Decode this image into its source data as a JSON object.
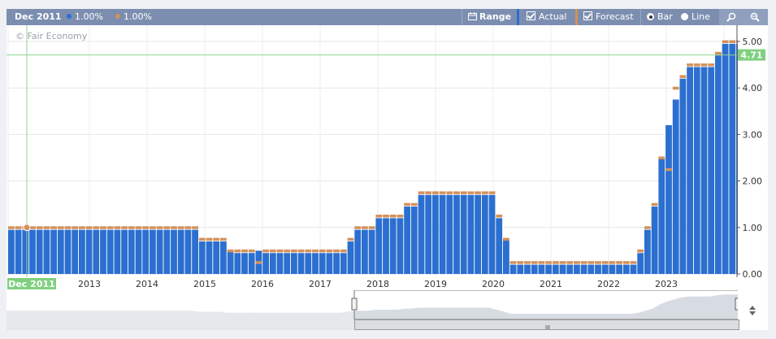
{
  "toolbar": {
    "date": "Dec 2011",
    "actual_value": "1.00%",
    "forecast_value": "1.00%",
    "range_label": "Range",
    "actual_label": "Actual",
    "forecast_label": "Forecast",
    "bar_label": "Bar",
    "line_label": "Line",
    "actual_color": "#2b6fd0",
    "forecast_color": "#d4915a"
  },
  "watermark": "© Fair Economy",
  "cursor_date": "Dec 2011",
  "current_value_label": "4.71",
  "chart_data": {
    "type": "bar",
    "ylim": [
      0,
      5
    ],
    "yticks": [
      "0.00",
      "1.00",
      "2.00",
      "3.00",
      "4.00",
      "5.00"
    ],
    "xticks": [
      "2013",
      "2014",
      "2015",
      "2016",
      "2017",
      "2018",
      "2019",
      "2020",
      "2021",
      "2022",
      "2023"
    ],
    "crosshair_value": 4.71,
    "series": [
      {
        "name": "Actual",
        "values": [
          0.95,
          0.95,
          0.95,
          0.95,
          0.95,
          0.95,
          0.95,
          0.95,
          0.95,
          0.95,
          0.95,
          0.95,
          0.95,
          0.95,
          0.95,
          0.95,
          0.95,
          0.95,
          0.95,
          0.95,
          0.95,
          0.95,
          0.95,
          0.95,
          0.95,
          0.95,
          0.95,
          0.7,
          0.7,
          0.7,
          0.7,
          0.5,
          0.45,
          0.45,
          0.45,
          0.5,
          0.45,
          0.45,
          0.45,
          0.45,
          0.45,
          0.45,
          0.45,
          0.45,
          0.45,
          0.45,
          0.45,
          0.45,
          0.7,
          0.95,
          0.95,
          0.95,
          1.2,
          1.2,
          1.2,
          1.2,
          1.45,
          1.45,
          1.7,
          1.7,
          1.7,
          1.7,
          1.7,
          1.7,
          1.7,
          1.7,
          1.7,
          1.7,
          1.7,
          1.2,
          0.75,
          0.2,
          0.2,
          0.2,
          0.2,
          0.2,
          0.2,
          0.2,
          0.2,
          0.2,
          0.2,
          0.2,
          0.2,
          0.2,
          0.2,
          0.2,
          0.2,
          0.2,
          0.2,
          0.45,
          0.95,
          1.45,
          2.5,
          3.2,
          3.75,
          4.2,
          4.45,
          4.45,
          4.45,
          4.45,
          4.7,
          4.95,
          4.95,
          4.95
        ]
      },
      {
        "name": "Forecast",
        "values": [
          1.0,
          1.0,
          1.0,
          1.0,
          1.0,
          1.0,
          1.0,
          1.0,
          1.0,
          1.0,
          1.0,
          1.0,
          1.0,
          1.0,
          1.0,
          1.0,
          1.0,
          1.0,
          1.0,
          1.0,
          1.0,
          1.0,
          1.0,
          1.0,
          1.0,
          1.0,
          1.0,
          0.75,
          0.75,
          0.75,
          0.75,
          0.5,
          0.5,
          0.5,
          0.5,
          0.25,
          0.5,
          0.5,
          0.5,
          0.5,
          0.5,
          0.5,
          0.5,
          0.5,
          0.5,
          0.5,
          0.5,
          0.5,
          0.75,
          1.0,
          1.0,
          1.0,
          1.25,
          1.25,
          1.25,
          1.25,
          1.5,
          1.5,
          1.75,
          1.75,
          1.75,
          1.75,
          1.75,
          1.75,
          1.75,
          1.75,
          1.75,
          1.75,
          1.75,
          1.25,
          0.75,
          0.25,
          0.25,
          0.25,
          0.25,
          0.25,
          0.25,
          0.25,
          0.25,
          0.25,
          0.25,
          0.25,
          0.25,
          0.25,
          0.25,
          0.25,
          0.25,
          0.25,
          0.25,
          0.5,
          1.0,
          1.5,
          2.5,
          2.25,
          4.0,
          4.25,
          4.5,
          4.5,
          4.5,
          4.5,
          4.75,
          5.0,
          5.0,
          5.0
        ]
      }
    ]
  },
  "navigator": {
    "left_handle": "handle-left",
    "right_handle": "handle-right"
  }
}
